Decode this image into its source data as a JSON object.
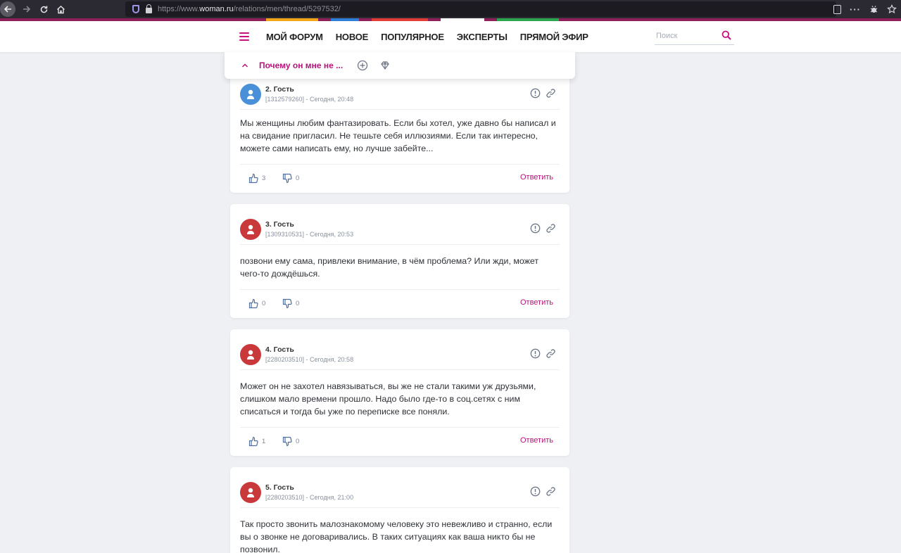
{
  "browser": {
    "url_prefix": "https://www.",
    "url_domain": "woman.ru",
    "url_path": "/relations/men/thread/5297532/",
    "menu_dots": "···"
  },
  "header": {
    "nav": [
      "МОЙ ФОРУМ",
      "НОВОЕ",
      "ПОПУЛЯРНОЕ",
      "ЭКСПЕРТЫ",
      "ПРЯМОЙ ЭФИР"
    ],
    "search_placeholder": "Поиск",
    "accent": "#c8107a"
  },
  "thread": {
    "title": "Почему он мне не ..."
  },
  "posts": [
    {
      "author": "2. Гость",
      "meta": "[1312579260] - Сегодня, 20:48",
      "avatar_color": "#4a90d9",
      "text": "Мы женщины любим фантазировать. Если бы хотел, уже давно бы написал и на свидание пригласил. Не тешьте себя иллюзиями. Если так интересно, можете сами написать ему, но лучше забейте...",
      "likes": "3",
      "dislikes": "0",
      "reply": "Ответить"
    },
    {
      "author": "3. Гость",
      "meta": "[1309310531] - Сегодня, 20:53",
      "avatar_color": "#c9383b",
      "text": "позвони ему сама, привлеки внимание, в чём проблема? Или жди, может чего-то дождёшься.",
      "likes": "0",
      "dislikes": "0",
      "reply": "Ответить"
    },
    {
      "author": "4. Гость",
      "meta": "[2280203510] - Сегодня, 20:58",
      "avatar_color": "#c9383b",
      "text": "Может он не захотел навязываться, вы же не стали такими уж друзьями, слишком мало времени прошло. Надо было где-то в соц.сетях с ним списаться и тогда бы уже по переписке все поняли.",
      "likes": "1",
      "dislikes": "0",
      "reply": "Ответить"
    },
    {
      "author": "5. Гость",
      "meta": "[2280203510] - Сегодня, 21:00",
      "avatar_color": "#c9383b",
      "text": "Так просто звонить малознакомому человеку это невежливо и странно, если вы о звонке не договаривались. В таких ситуациях как ваша никто бы не позвонил."
    }
  ]
}
